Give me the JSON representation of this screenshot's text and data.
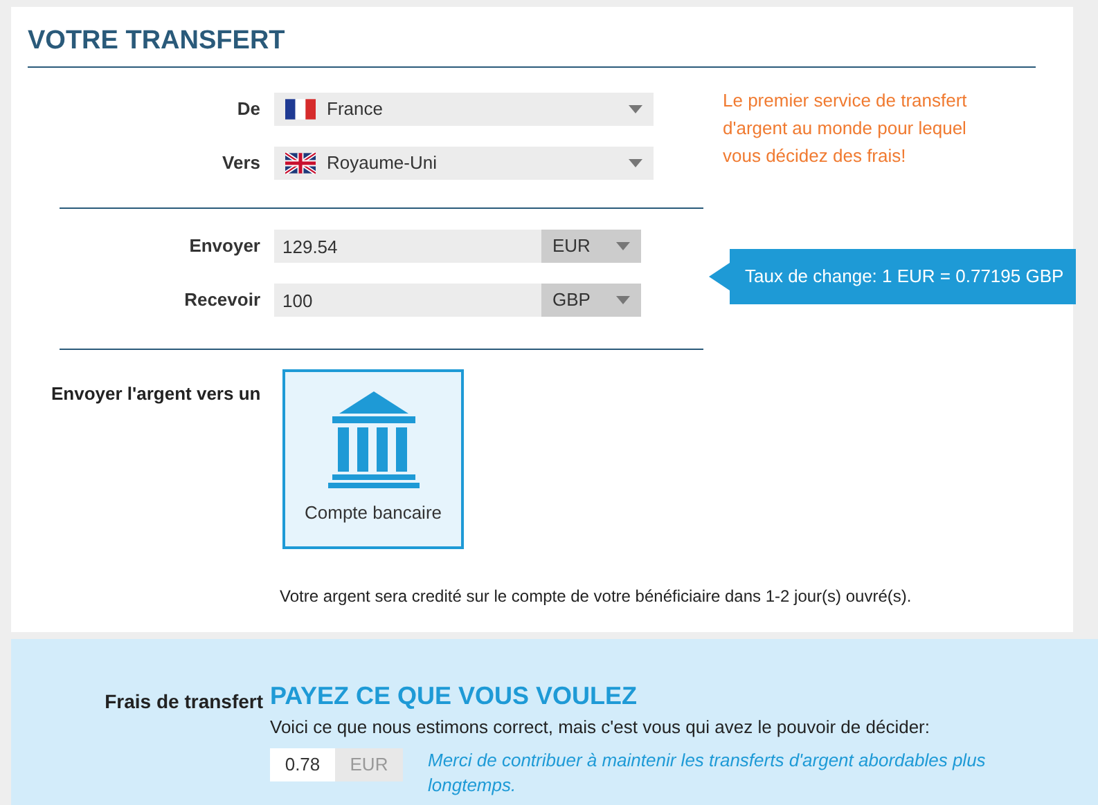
{
  "title": "VOTRE TRANSFERT",
  "countries": [
    {
      "label": "De",
      "kind": "fr",
      "value": "France"
    },
    {
      "label": "Vers",
      "kind": "gb",
      "value": "Royaume-Uni"
    }
  ],
  "promo": "Le premier service de transfert d'argent au monde pour lequel vous décidez des frais!",
  "amounts": [
    {
      "label": "Envoyer",
      "value": "129.54",
      "currency": "EUR"
    },
    {
      "label": "Recevoir",
      "value": "100",
      "currency": "GBP"
    }
  ],
  "exchange_rate": "Taux de change: 1 EUR = 0.77195 GBP",
  "payout": {
    "label": "Envoyer l'argent vers un",
    "options": [
      {
        "label": "Compte bancaire",
        "selected": true
      }
    ],
    "note": "Votre argent sera credité sur le compte de votre bénéficiaire dans 1-2 jour(s) ouvré(s)."
  },
  "fees": {
    "label": "Frais de transfert",
    "heading": "PAYEZ CE QUE VOUS VOULEZ",
    "text": "Voici ce que nous estimons correct, mais c'est vous qui avez le pouvoir de décider:",
    "value": "0.78",
    "currency": "EUR",
    "thanks": "Merci de contribuer à maintenir les transferts d'argent abordables plus longtemps."
  }
}
